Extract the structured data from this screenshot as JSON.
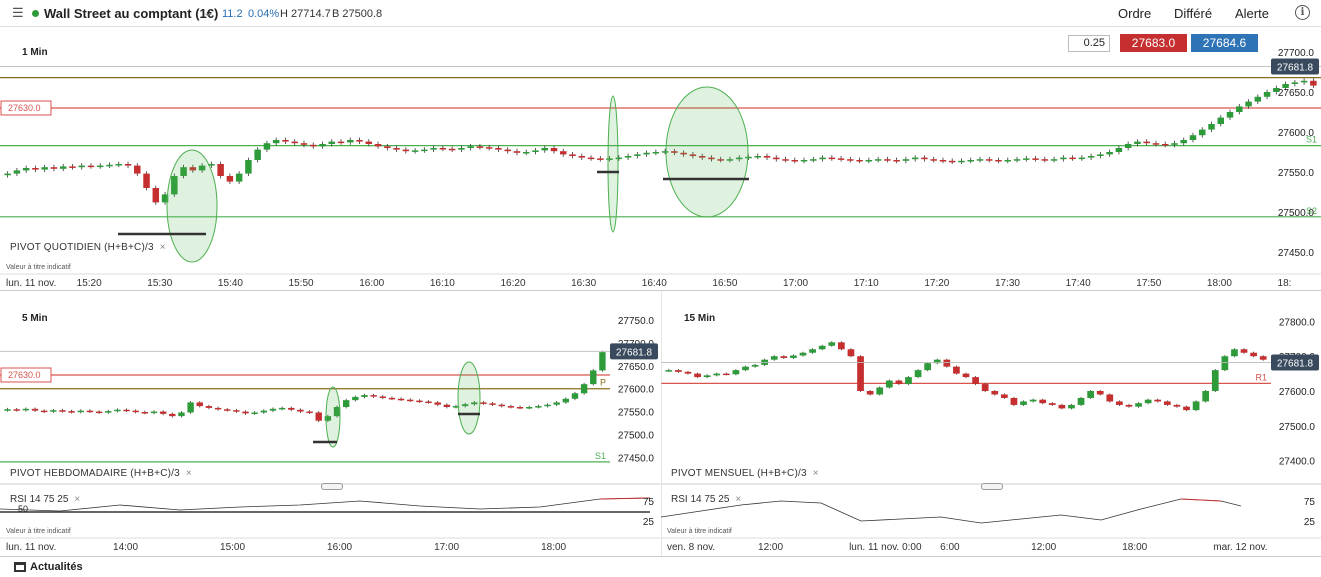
{
  "header": {
    "menu_icon": "hamburger-icon",
    "market_status_color": "#2e9b3a",
    "instrument_title": "Wall Street au comptant (1€)",
    "change_points": "11.2",
    "change_pct": "0.04%",
    "high": "H 27714.7",
    "bid": "B 27500.8",
    "menu": [
      "Ordre",
      "Différé",
      "Alerte"
    ],
    "info_icon": "i"
  },
  "deal": {
    "quantity": "0.25",
    "sell_price": "27683.0",
    "buy_price": "27684.6",
    "sell_color": "#c62f2f",
    "buy_color": "#2e73b6"
  },
  "colors": {
    "up": "#2e9b3a",
    "down": "#c62f2f",
    "pivot": "#8a6d1e",
    "support": "#4caf50",
    "resistance": "#d9534f"
  },
  "chart_data": [
    {
      "type": "candlestick",
      "timeframe": "1 Min",
      "indicator": "PIVOT  QUOTIDIEN  (H+B+C)/3",
      "note": "Valeur à titre indicatif",
      "y_ticks": [
        "27700.0",
        "27650.0",
        "27600.0",
        "27550.0",
        "27500.0",
        "27450.0"
      ],
      "ylim": [
        27430,
        27715
      ],
      "x_ticks": [
        "lun. 11 nov.",
        "15:20",
        "15:30",
        "15:40",
        "15:50",
        "16:00",
        "16:10",
        "16:20",
        "16:30",
        "16:40",
        "16:50",
        "17:00",
        "17:10",
        "17:20",
        "17:30",
        "17:40",
        "17:50",
        "18:00",
        "18:"
      ],
      "last_price": "27681.8",
      "levels": [
        {
          "name": "Piv",
          "value": 27668,
          "kind": "pivot"
        },
        {
          "name": "",
          "label": "27630.0",
          "value": 27630,
          "kind": "alert"
        },
        {
          "name": "S1",
          "value": 27583,
          "kind": "support"
        },
        {
          "name": "S2",
          "value": 27494,
          "kind": "support"
        }
      ],
      "closes": [
        27548,
        27552,
        27555,
        27553,
        27556,
        27554,
        27557,
        27556,
        27558,
        27557,
        27558,
        27559,
        27560,
        27558,
        27548,
        27530,
        27512,
        27522,
        27545,
        27556,
        27552,
        27558,
        27560,
        27545,
        27538,
        27548,
        27565,
        27578,
        27586,
        27590,
        27588,
        27586,
        27584,
        27582,
        27585,
        27588,
        27587,
        27590,
        27588,
        27585,
        27582,
        27580,
        27578,
        27576,
        27577,
        27578,
        27580,
        27579,
        27578,
        27580,
        27582,
        27581,
        27580,
        27578,
        27576,
        27574,
        27575,
        27577,
        27580,
        27576,
        27572,
        27570,
        27568,
        27567,
        27566,
        27567,
        27568,
        27570,
        27572,
        27574,
        27575,
        27576,
        27574,
        27572,
        27570,
        27568,
        27566,
        27565,
        27566,
        27568,
        27569,
        27570,
        27568,
        27566,
        27565,
        27564,
        27565,
        27566,
        27568,
        27567,
        27566,
        27565,
        27564,
        27565,
        27566,
        27565,
        27564,
        27566,
        27568,
        27566,
        27565,
        27564,
        27563,
        27564,
        27565,
        27566,
        27565,
        27564,
        27565,
        27566,
        27567,
        27566,
        27565,
        27566,
        27568,
        27567,
        27568,
        27570,
        27572,
        27575,
        27580,
        27585,
        27588,
        27586,
        27585,
        27584,
        27586,
        27590,
        27596,
        27603,
        27610,
        27618,
        27625,
        27632,
        27638,
        27644,
        27650,
        27655,
        27660,
        27662,
        27664,
        27658
      ]
    },
    {
      "type": "candlestick",
      "timeframe": "5 Min",
      "indicator": "PIVOT  HEBDOMADAIRE  (H+B+C)/3",
      "y_ticks": [
        "27750.0",
        "27700.0",
        "27650.0",
        "27600.0",
        "27550.0",
        "27500.0",
        "27450.0"
      ],
      "ylim": [
        27420,
        27770
      ],
      "x_ticks": [
        "lun. 11 nov.",
        "14:00",
        "15:00",
        "16:00",
        "17:00",
        "18:00"
      ],
      "last_price": "27681.8",
      "levels": [
        {
          "name": "",
          "label": "27630.0",
          "value": 27630,
          "kind": "alert"
        },
        {
          "name": "P",
          "value": 27600,
          "kind": "pivot"
        },
        {
          "name": "S1",
          "value": 27440,
          "kind": "support"
        }
      ],
      "closes": [
        27555,
        27553,
        27556,
        27552,
        27550,
        27553,
        27551,
        27549,
        27552,
        27550,
        27548,
        27551,
        27554,
        27552,
        27549,
        27547,
        27550,
        27545,
        27540,
        27548,
        27570,
        27562,
        27558,
        27555,
        27553,
        27550,
        27546,
        27548,
        27552,
        27556,
        27558,
        27554,
        27550,
        27548,
        27530,
        27540,
        27560,
        27575,
        27582,
        27586,
        27583,
        27580,
        27578,
        27576,
        27574,
        27572,
        27570,
        27565,
        27560,
        27562,
        27566,
        27570,
        27568,
        27565,
        27562,
        27560,
        27558,
        27560,
        27562,
        27565,
        27570,
        27578,
        27590,
        27610,
        27640,
        27680
      ]
    },
    {
      "type": "candlestick",
      "timeframe": "15 Min",
      "indicator": "PIVOT  MENSUEL  (H+B+C)/3",
      "y_ticks": [
        "27800.0",
        "27700.0",
        "27600.0",
        "27500.0",
        "27400.0"
      ],
      "ylim": [
        27370,
        27830
      ],
      "x_ticks": [
        "ven. 8 nov.",
        "12:00",
        "lun. 11 nov. 0:00",
        "6:00",
        "12:00",
        "18:00",
        "mar. 12 nov."
      ],
      "last_price": "27681.8",
      "levels": [
        {
          "name": "R1",
          "value": 27622,
          "kind": "resistance"
        }
      ],
      "closes": [
        27660,
        27655,
        27650,
        27640,
        27645,
        27650,
        27648,
        27660,
        27670,
        27675,
        27690,
        27700,
        27695,
        27702,
        27710,
        27720,
        27730,
        27740,
        27720,
        27700,
        27600,
        27590,
        27610,
        27630,
        27620,
        27640,
        27660,
        27680,
        27690,
        27670,
        27650,
        27640,
        27620,
        27600,
        27590,
        27580,
        27560,
        27570,
        27575,
        27565,
        27560,
        27550,
        27560,
        27580,
        27600,
        27590,
        27570,
        27560,
        27555,
        27565,
        27575,
        27570,
        27560,
        27555,
        27545,
        27570,
        27600,
        27660,
        27700,
        27720,
        27710,
        27700,
        27690
      ]
    }
  ],
  "panel_5": {
    "rsi_label": "RSI  14  75  25",
    "rsi_levels": [
      "75",
      "50",
      "25"
    ],
    "note": "Valeur à titre indicatif"
  },
  "panel_15": {
    "rsi_label": "RSI  14  75  25",
    "rsi_levels": [
      "75",
      "25"
    ],
    "note": "Valeur à titre indicatif"
  },
  "close_icon": "×",
  "footer": {
    "label": "Actualités"
  }
}
